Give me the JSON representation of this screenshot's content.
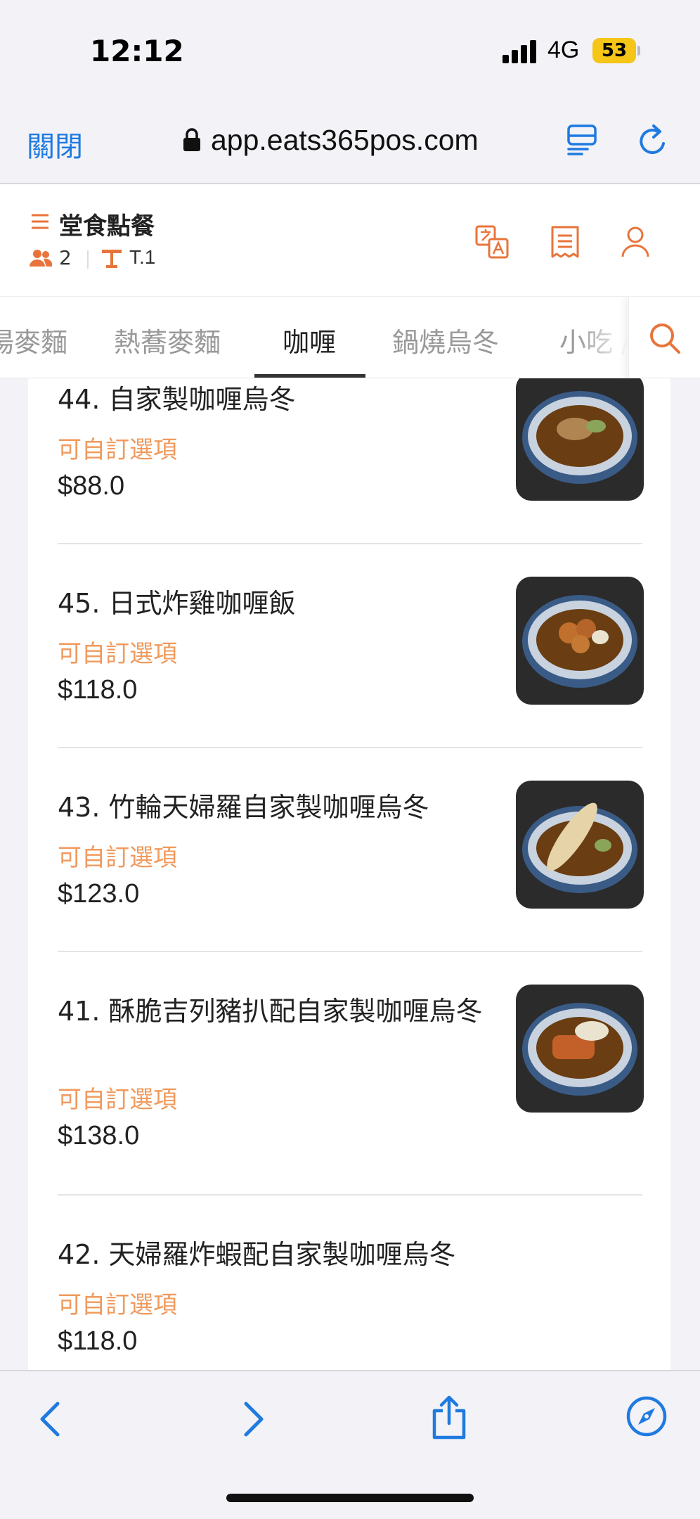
{
  "status_bar": {
    "time": "12:12",
    "network": "4G",
    "battery": "53"
  },
  "browser": {
    "close_label": "關閉",
    "url": "app.eats365pos.com",
    "icons": [
      "lock-icon",
      "reader-icon",
      "reload-icon"
    ]
  },
  "header": {
    "title": "堂食點餐",
    "guests": "2",
    "table": "T.1",
    "icons": [
      "translate-icon",
      "receipt-icon",
      "user-icon"
    ],
    "accent_color": "#e8743b"
  },
  "tabs": {
    "items": [
      "湯麥麵",
      "熱蕎麥麵",
      "咖喱",
      "鍋燒烏冬",
      "小吃 / "
    ],
    "active": "咖喱"
  },
  "menu": {
    "option_label_color": "#f09a5e",
    "items": [
      {
        "name": "44. 自家製咖喱烏冬",
        "option": "可自訂選項",
        "price": "$88.0"
      },
      {
        "name": "45. 日式炸雞咖喱飯",
        "option": "可自訂選項",
        "price": "$118.0"
      },
      {
        "name": "43. 竹輪天婦羅自家製咖喱烏冬",
        "option": "可自訂選項",
        "price": "$123.0"
      },
      {
        "name": "41. 酥脆吉列豬扒配自家製咖喱烏冬",
        "option": "可自訂選項",
        "price": "$138.0"
      },
      {
        "name": "42. 天婦羅炸蝦配自家製咖喱烏冬",
        "option": "可自訂選項",
        "price": "$118.0"
      }
    ]
  },
  "toolbar": {
    "icons": [
      "back-icon",
      "forward-icon",
      "share-icon",
      "compass-icon"
    ]
  }
}
